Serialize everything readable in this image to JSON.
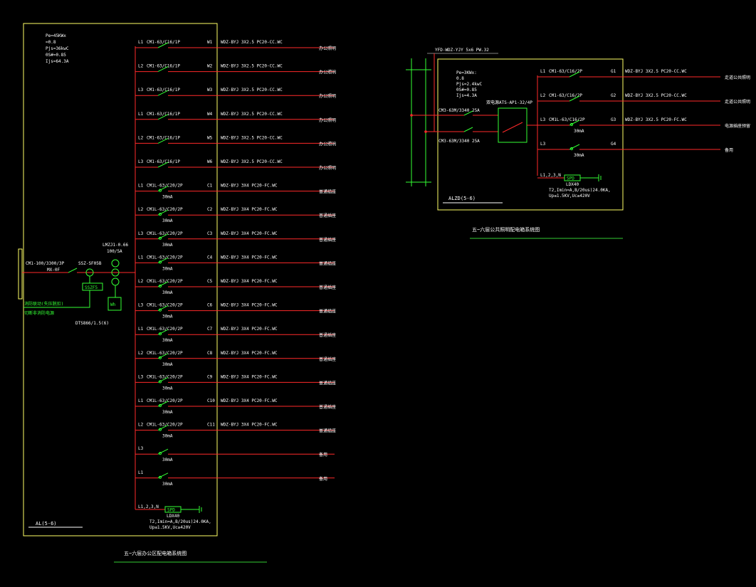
{
  "colors": {
    "background": "#000000",
    "frame": "#ffff66",
    "wire": "#ff2a2a",
    "switch": "#33ff33",
    "text": "#ffffff",
    "title_line": "#33cc33"
  },
  "panel1": {
    "name": "AL(5-6)",
    "title": "五~六层办公区配电箱系统图",
    "params": [
      "Pe=45KWx",
      "=0.8",
      "Pjs=36kwC",
      "0S#=0.85",
      "Ijs=64.3A"
    ],
    "incoming": {
      "breaker": "CM1-100/3300/3P",
      "switch": "MX-0F",
      "spd": "SSZ-SF05B",
      "spd_box": "SSZF5",
      "meter_spec": "LMZJ1-0.66",
      "meter_ratio": "100/5A",
      "meter_box": "Wh",
      "meter_model": "DTS866/1.5(6)"
    },
    "green_notes": [
      "消防联动(失压脱扣)",
      "切断非消防电源"
    ],
    "circuits": [
      {
        "phase": "L1",
        "breaker": "CM1-63/C16/1P",
        "rcd": "",
        "id": "W1",
        "cable": "WDZ-BYJ 3X2.5 PC20-CC.WC",
        "load": "办公照明"
      },
      {
        "phase": "L2",
        "breaker": "CM1-63/C16/1P",
        "rcd": "",
        "id": "W2",
        "cable": "WDZ-BYJ 3X2.5 PC20-CC.WC",
        "load": "办公照明"
      },
      {
        "phase": "L3",
        "breaker": "CM1-63/C16/1P",
        "rcd": "",
        "id": "W3",
        "cable": "WDZ-BYJ 3X2.5 PC20-CC.WC",
        "load": "办公照明"
      },
      {
        "phase": "L1",
        "breaker": "CM1-63/C16/1P",
        "rcd": "",
        "id": "W4",
        "cable": "WDZ-BYJ 3X2.5 PC20-CC.WC",
        "load": "办公照明"
      },
      {
        "phase": "L2",
        "breaker": "CM1-63/C16/1P",
        "rcd": "",
        "id": "W5",
        "cable": "WDZ-BYJ 3X2.5 PC20-CC.WC",
        "load": "办公照明"
      },
      {
        "phase": "L3",
        "breaker": "CM1-63/C16/1P",
        "rcd": "",
        "id": "W6",
        "cable": "WDZ-BYJ 3X2.5 PC20-CC.WC",
        "load": "办公照明"
      },
      {
        "phase": "L1",
        "breaker": "CM1L-63/C20/2P",
        "rcd": "30mA",
        "id": "C1",
        "cable": "WDZ-BYJ 3X4 PC20-FC.WC",
        "load": "普通插座"
      },
      {
        "phase": "L2",
        "breaker": "CM1L-63/C20/2P",
        "rcd": "30mA",
        "id": "C2",
        "cable": "WDZ-BYJ 3X4 PC20-FC.WC",
        "load": "普通插座"
      },
      {
        "phase": "L3",
        "breaker": "CM1L-63/C20/2P",
        "rcd": "30mA",
        "id": "C3",
        "cable": "WDZ-BYJ 3X4 PC20-FC.WC",
        "load": "普通插座"
      },
      {
        "phase": "L1",
        "breaker": "CM1L-63/C20/2P",
        "rcd": "30mA",
        "id": "C4",
        "cable": "WDZ-BYJ 3X4 PC20-FC.WC",
        "load": "普通插座"
      },
      {
        "phase": "L2",
        "breaker": "CM1L-63/C20/2P",
        "rcd": "30mA",
        "id": "C5",
        "cable": "WDZ-BYJ 3X4 PC20-FC.WC",
        "load": "普通插座"
      },
      {
        "phase": "L3",
        "breaker": "CM1L-63/C20/2P",
        "rcd": "30mA",
        "id": "C6",
        "cable": "WDZ-BYJ 3X4 PC20-FC.WC",
        "load": "普通插座"
      },
      {
        "phase": "L1",
        "breaker": "CM1L-63/C20/2P",
        "rcd": "30mA",
        "id": "C7",
        "cable": "WDZ-BYJ 3X4 PC20-FC.WC",
        "load": "普通插座"
      },
      {
        "phase": "L2",
        "breaker": "CM1L-63/C20/2P",
        "rcd": "30mA",
        "id": "C8",
        "cable": "WDZ-BYJ 3X4 PC20-FC.WC",
        "load": "普通插座"
      },
      {
        "phase": "L3",
        "breaker": "CM1L-63/C20/2P",
        "rcd": "30mA",
        "id": "C9",
        "cable": "WDZ-BYJ 3X4 PC20-FC.WC",
        "load": "普通插座"
      },
      {
        "phase": "L1",
        "breaker": "CM1L-63/C20/2P",
        "rcd": "30mA",
        "id": "C10",
        "cable": "WDZ-BYJ 3X4 PC20-FC.WC",
        "load": "普通插座"
      },
      {
        "phase": "L2",
        "breaker": "CM1L-63/C20/2P",
        "rcd": "30mA",
        "id": "C11",
        "cable": "WDZ-BYJ 3X4 PC20-FC.WC",
        "load": "普通插座"
      },
      {
        "phase": "L3",
        "breaker": "",
        "rcd": "30mA",
        "id": "",
        "cable": "",
        "load": "备用"
      },
      {
        "phase": "L1",
        "breaker": "",
        "rcd": "30mA",
        "id": "",
        "cable": "",
        "load": "备用"
      }
    ],
    "spd_row": {
      "phase": "L1,2,3,N",
      "box": "SPD",
      "model": "LDX40",
      "spec1": "T2,Imin=A,B/20us)24.0KA,",
      "spec2": "Up≤1.5KV,Uc≥420V"
    }
  },
  "panel2": {
    "name": "ALZD(5-6)",
    "title": "五~六层公共照明配电箱系统图",
    "feeder": "YFD-WDZ-YJY 5x6 PW.32",
    "params": [
      "Pe=3KWx:",
      "0.8",
      "Pjs=2.4kwC",
      "0S#=0.85",
      "Ijs=4.3A"
    ],
    "inputs": [
      "CM3-63M/3340 25A",
      "CM3-63M/3340 25A"
    ],
    "ats": "双电源ATS-AP1-32/4P",
    "circuits": [
      {
        "phase": "L1",
        "breaker": "CM1-63/C16/2P",
        "rcd": "",
        "id": "G1",
        "cable": "WDZ-BYJ 3X2.5 PC20-CC.WC",
        "load": "走道公共照明"
      },
      {
        "phase": "L2",
        "breaker": "CM1-63/C16/2P",
        "rcd": "",
        "id": "G2",
        "cable": "WDZ-BYJ 3X2.5 PC20-CC.WC",
        "load": "走道公共照明"
      },
      {
        "phase": "L3",
        "breaker": "CM1L-63/C16/2P",
        "rcd": "30mA",
        "id": "G3",
        "cable": "WDZ-BYJ 3X2.5 PC20-FC.WC",
        "load": "电源插座预留"
      },
      {
        "phase": "L3",
        "breaker": "",
        "rcd": "30mA",
        "id": "G4",
        "cable": "",
        "load": "备用"
      }
    ],
    "spd_row": {
      "phase": "L1,2,3,N",
      "box": "SPD",
      "model": "LDX40",
      "spec1": "T2,Imin=A,B/20us)24.0KA,",
      "spec2": "Up≤1.5KV,Uc≥420V"
    }
  }
}
